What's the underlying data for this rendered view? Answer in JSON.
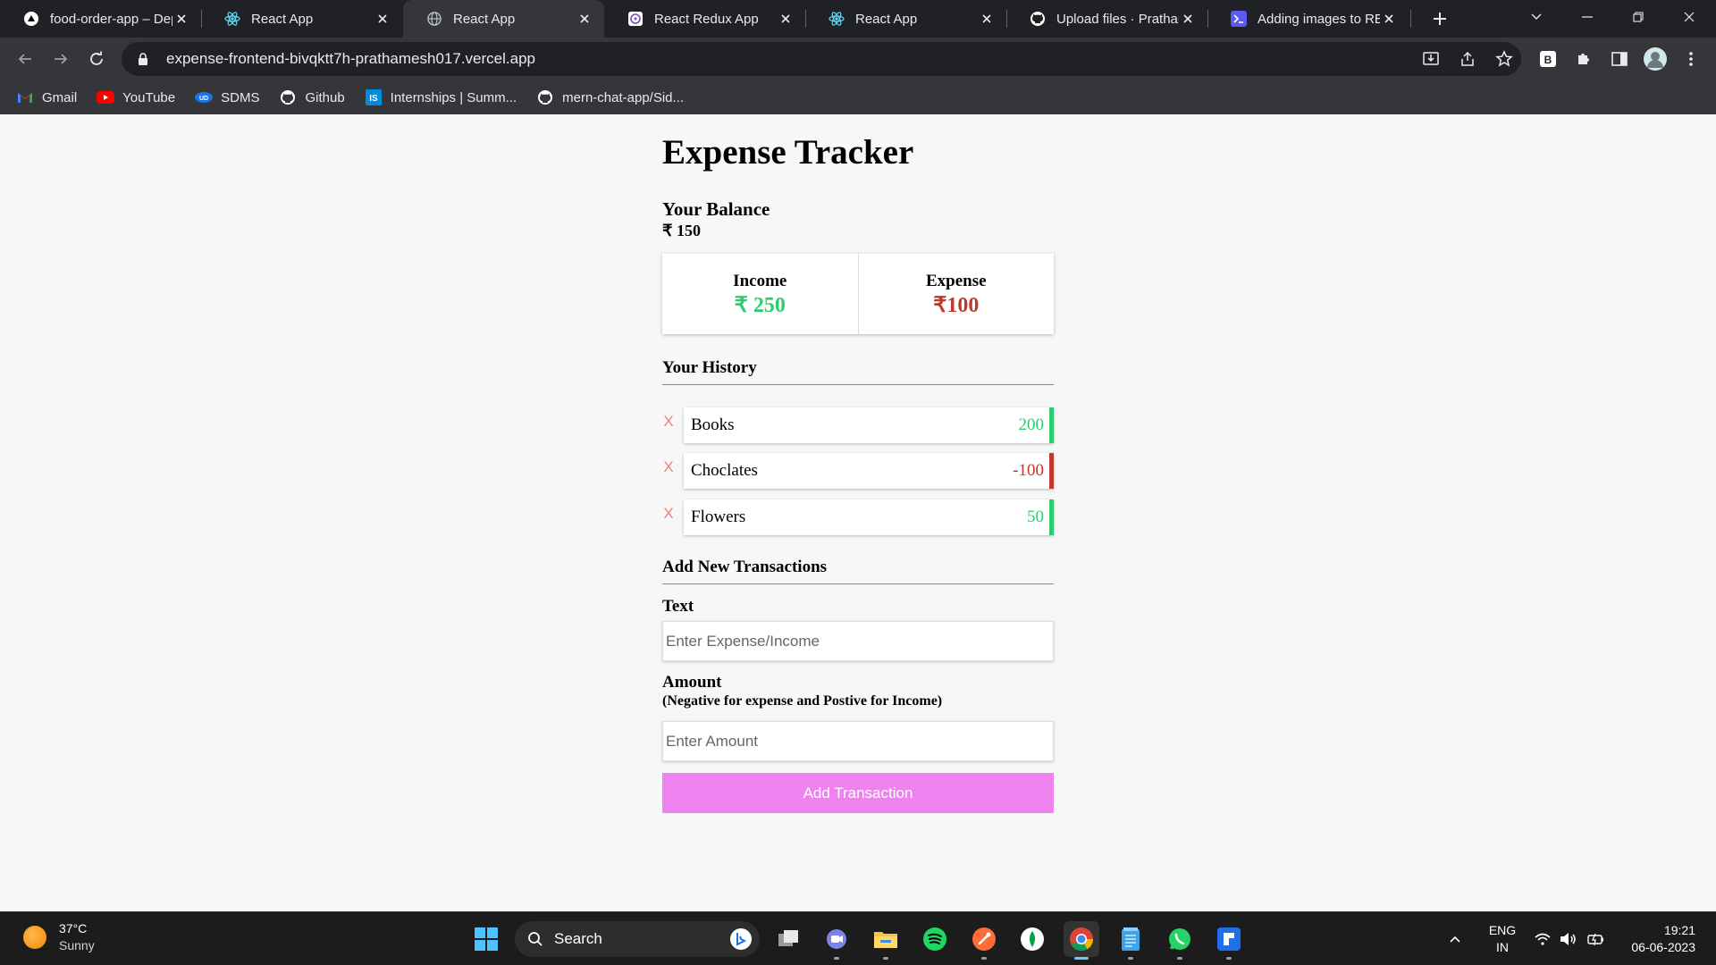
{
  "browser": {
    "tabs": [
      {
        "title": "food-order-app – Dep",
        "icon": "vercel-icon",
        "active": false
      },
      {
        "title": "React App",
        "icon": "react-icon",
        "active": false
      },
      {
        "title": "React App",
        "icon": "globe-icon",
        "active": true
      },
      {
        "title": "React Redux App",
        "icon": "redux-icon",
        "active": false
      },
      {
        "title": "React App",
        "icon": "react-icon",
        "active": false
      },
      {
        "title": "Upload files · Pratham",
        "icon": "github-icon",
        "active": false
      },
      {
        "title": "Adding images to RE",
        "icon": "terminal-icon",
        "active": false
      }
    ],
    "url": "expense-frontend-bivqktt7h-prathamesh017.vercel.app",
    "bookmarks": [
      {
        "label": "Gmail",
        "icon": "gmail-icon"
      },
      {
        "label": "YouTube",
        "icon": "youtube-icon"
      },
      {
        "label": "SDMS",
        "icon": "sdms-icon"
      },
      {
        "label": "Github",
        "icon": "github-icon"
      },
      {
        "label": "Internships | Summ...",
        "icon": "internshala-icon"
      },
      {
        "label": "mern-chat-app/Sid...",
        "icon": "github-icon"
      }
    ],
    "profile_letter": "B"
  },
  "app": {
    "title": "Expense Tracker",
    "balance_label": "Your Balance",
    "balance_value": "₹ 150",
    "income_label": "Income",
    "income_value": "₹ 250",
    "expense_label": "Expense",
    "expense_value": "₹100",
    "history_heading": "Your History",
    "history": [
      {
        "text": "Books",
        "amount": "200",
        "type": "plus",
        "delete": "X"
      },
      {
        "text": "Choclates",
        "amount": "-100",
        "type": "minus",
        "delete": "X"
      },
      {
        "text": "Flowers",
        "amount": "50",
        "type": "plus",
        "delete": "X"
      }
    ],
    "add_heading": "Add New Transactions",
    "text_label": "Text",
    "text_placeholder": "Enter Expense/Income",
    "amount_label": "Amount",
    "amount_note": "(Negative for expense and Postive for Income)",
    "amount_placeholder": "Enter Amount",
    "submit_label": "Add Transaction",
    "colors": {
      "income": "#2ecc71",
      "expense": "#c0392b",
      "button": "#ee82ee",
      "delete": "#f08080"
    }
  },
  "taskbar": {
    "weather_temp": "37°C",
    "weather_desc": "Sunny",
    "search_label": "Search",
    "lang_line1": "ENG",
    "lang_line2": "IN",
    "time": "19:21",
    "date": "06-06-2023"
  }
}
